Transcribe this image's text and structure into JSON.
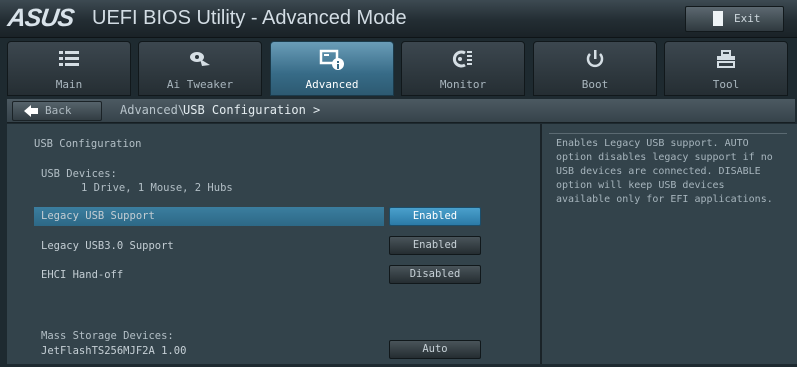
{
  "app": {
    "logo": "ASUS",
    "title": "UEFI BIOS Utility - Advanced Mode",
    "exit_label": "Exit"
  },
  "tabs": [
    {
      "label": "Main",
      "icon": "list-icon"
    },
    {
      "label": "Ai Tweaker",
      "icon": "fan-icon"
    },
    {
      "label": "Advanced",
      "icon": "advanced-icon",
      "active": true
    },
    {
      "label": "Monitor",
      "icon": "monitor-gauge-icon"
    },
    {
      "label": "Boot",
      "icon": "power-icon"
    },
    {
      "label": "Tool",
      "icon": "tool-icon"
    }
  ],
  "breadcrumb": {
    "back_label": "Back",
    "path_1": "Advanced\\",
    "path_2": "USB Configuration >"
  },
  "content": {
    "section_title": "USB Configuration",
    "devices_label": "USB Devices:",
    "devices_value": "1 Drive, 1 Mouse, 2 Hubs",
    "settings": [
      {
        "label": "Legacy USB Support",
        "value": "Enabled",
        "highlighted": true
      },
      {
        "label": "Legacy USB3.0 Support",
        "value": "Enabled"
      },
      {
        "label": "EHCI Hand-off",
        "value": "Disabled"
      }
    ],
    "mass_storage_label": "Mass Storage Devices:",
    "mass_storage_device": "JetFlashTS256MJF2A 1.00",
    "mass_storage_value": "Auto"
  },
  "help": {
    "text": "Enables Legacy USB support. AUTO\noption disables legacy support if no\nUSB devices are connected. DISABLE\noption will keep USB devices\navailable only for EFI applications."
  },
  "colors": {
    "accent": "#3b7e9f",
    "selected_option": "#2b7aa7",
    "background": "#33434b"
  }
}
